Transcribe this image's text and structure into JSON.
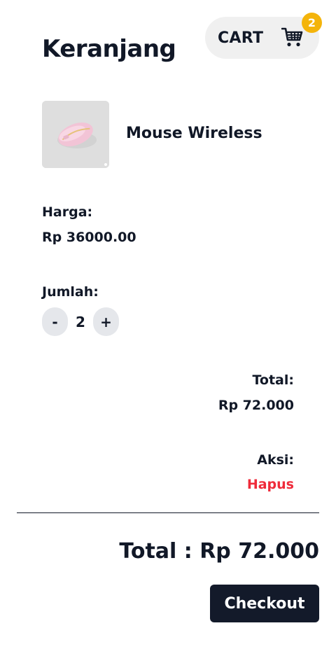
{
  "header": {
    "title": "Keranjang",
    "cart_label": "CART",
    "cart_count": "2",
    "cart_icon": "shopping-cart-icon"
  },
  "item": {
    "name": "Mouse Wireless",
    "image_icon": "pink-wireless-mouse-image",
    "price_label": "Harga:",
    "price_value": "Rp 36000.00",
    "qty_label": "Jumlah:",
    "qty_minus": "-",
    "qty_value": "2",
    "qty_plus": "+",
    "total_label": "Total:",
    "total_value": "Rp 72.000",
    "action_label": "Aksi:",
    "delete_label": "Hapus"
  },
  "summary": {
    "grand_total": "Total : Rp 72.000",
    "checkout_label": "Checkout"
  },
  "colors": {
    "primary_dark": "#131a2a",
    "badge": "#f4b40b",
    "danger": "#ef2b3a",
    "pill_bg": "#f0f0f0"
  }
}
